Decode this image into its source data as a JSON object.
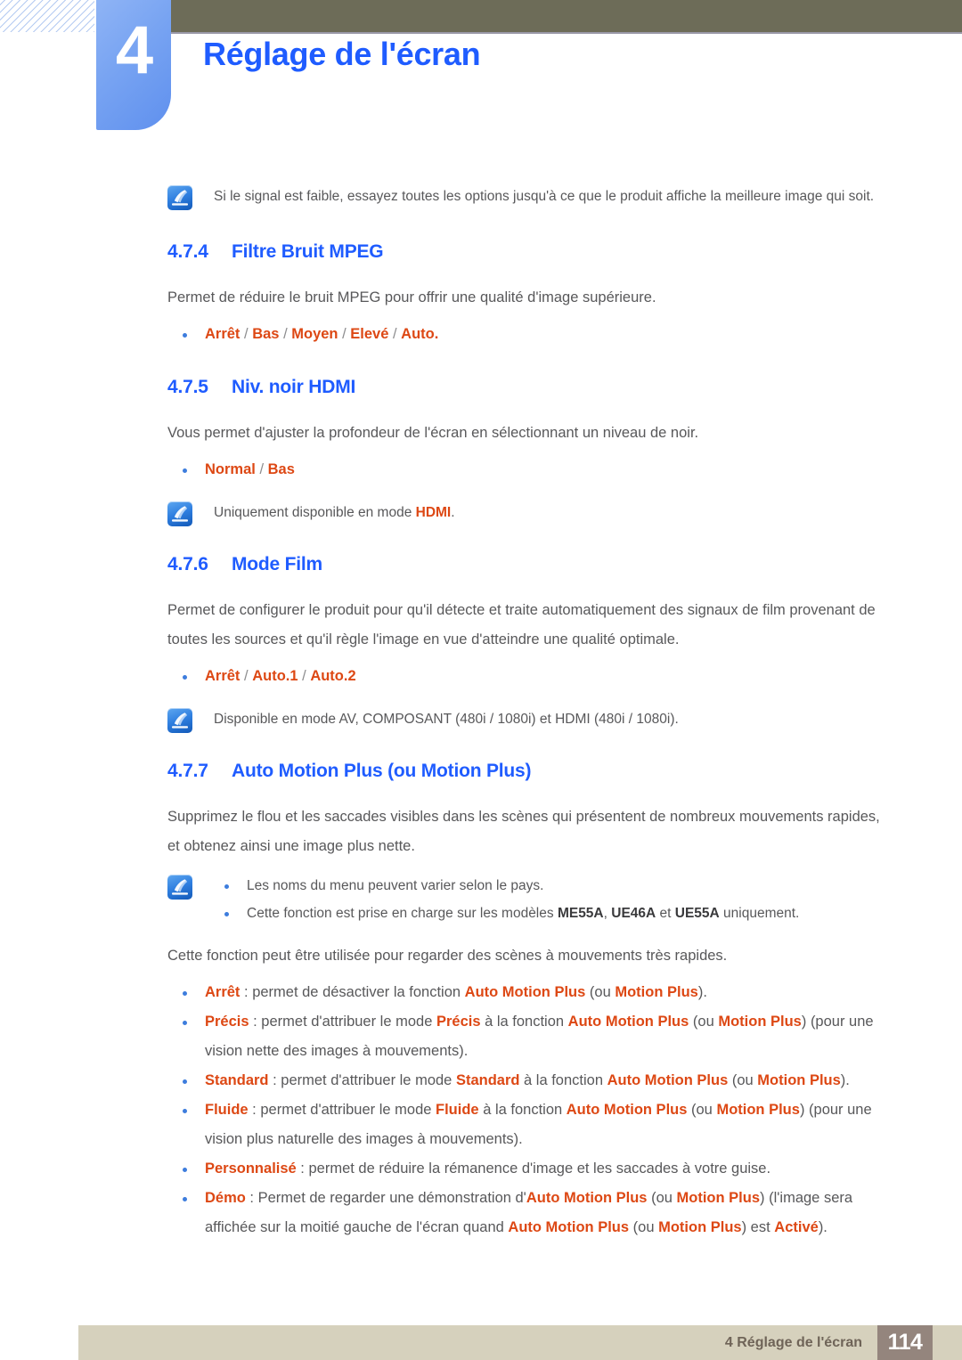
{
  "header": {
    "chapter_number": "4",
    "chapter_title": "Réglage de l'écran",
    "accent_blue": "#1f5cff",
    "tab_blue": "#77a3f2",
    "olive": "#6d6c58"
  },
  "notes": {
    "signal_note": "Si le signal est faible, essayez toutes les options jusqu'à ce que le produit affiche la meilleure image qui soit.",
    "hdmi_only_prefix": "Uniquement disponible en mode ",
    "hdmi_only_term": "HDMI",
    "hdmi_only_suffix": ".",
    "film_mode_note": "Disponible en mode AV, COMPOSANT (480i / 1080i) et HDMI (480i / 1080i).",
    "amp_note_1": "Les noms du menu peuvent varier selon le pays.",
    "amp_note_2_pre": "Cette fonction est prise en charge sur les modèles ",
    "amp_note_2_model1": "ME55A",
    "amp_note_2_sep1": ", ",
    "amp_note_2_model2": "UE46A",
    "amp_note_2_sep2": " et ",
    "amp_note_2_model3": "UE55A",
    "amp_note_2_post": " uniquement."
  },
  "sections": [
    {
      "number": "4.7.4",
      "title": "Filtre Bruit MPEG",
      "body": "Permet de réduire le bruit MPEG pour offrir une qualité d'image supérieure.",
      "options": [
        "Arrêt",
        "Bas",
        "Moyen",
        "Elevé",
        "Auto."
      ]
    },
    {
      "number": "4.7.5",
      "title": "Niv. noir HDMI",
      "body": "Vous permet d'ajuster la profondeur de l'écran en sélectionnant un niveau de noir.",
      "options": [
        "Normal",
        "Bas"
      ]
    },
    {
      "number": "4.7.6",
      "title": "Mode Film",
      "body": "Permet de configurer le produit pour qu'il détecte et traite automatiquement des signaux de film provenant de toutes les sources et qu'il règle l'image en vue d'atteindre une qualité optimale.",
      "options": [
        "Arrêt",
        "Auto.1",
        "Auto.2"
      ]
    },
    {
      "number": "4.7.7",
      "title": "Auto Motion Plus (ou Motion Plus)",
      "body": "Supprimez le flou et les saccades visibles dans les scènes qui présentent de nombreux mouvements rapides, et obtenez ainsi une image plus nette.",
      "body2": "Cette fonction peut être utilisée pour regarder des scènes à mouvements très rapides."
    }
  ],
  "amp_options": {
    "arret": {
      "term": "Arrêt",
      "t1": " : permet de désactiver la fonction ",
      "t2": "Auto Motion Plus",
      "t3": " (ou ",
      "t4": "Motion Plus",
      "t5": ")."
    },
    "precis": {
      "term": "Précis",
      "t1": " : permet d'attribuer le mode ",
      "t2": "Précis",
      "t3": " à la fonction ",
      "t4": "Auto Motion Plus",
      "t5": " (ou ",
      "t6": "Motion Plus",
      "t7": ") (pour une vision nette des images à mouvements)."
    },
    "standard": {
      "term": "Standard",
      "t1": " : permet d'attribuer le mode ",
      "t2": "Standard",
      "t3": " à la fonction ",
      "t4": "Auto Motion Plus",
      "t5": " (ou ",
      "t6": "Motion Plus",
      "t7": ")."
    },
    "fluide": {
      "term": "Fluide",
      "t1": " : permet d'attribuer le mode ",
      "t2": "Fluide",
      "t3": " à la fonction ",
      "t4": "Auto Motion Plus",
      "t5": " (ou ",
      "t6": "Motion Plus",
      "t7": ") (pour une vision plus naturelle des images à mouvements)."
    },
    "personnalise": {
      "term": "Personnalisé",
      "t1": " : permet de réduire la rémanence d'image et les saccades à votre guise."
    },
    "demo": {
      "term": "Démo",
      "t1": " : Permet de regarder une démonstration d'",
      "t2": "Auto Motion Plus",
      "t3": " (ou ",
      "t4": "Motion Plus",
      "t5": ") (l'image sera affichée sur la moitié gauche de l'écran quand ",
      "t6": "Auto Motion Plus",
      "t7": " (ou ",
      "t8": "Motion Plus",
      "t9": ") est ",
      "t10": "Activé",
      "t11": ")."
    }
  },
  "separator": " / ",
  "footer": {
    "label": "4 Réglage de l'écran",
    "page": "114",
    "bar_color": "#d6d1bd",
    "page_box_color": "#94857d"
  }
}
